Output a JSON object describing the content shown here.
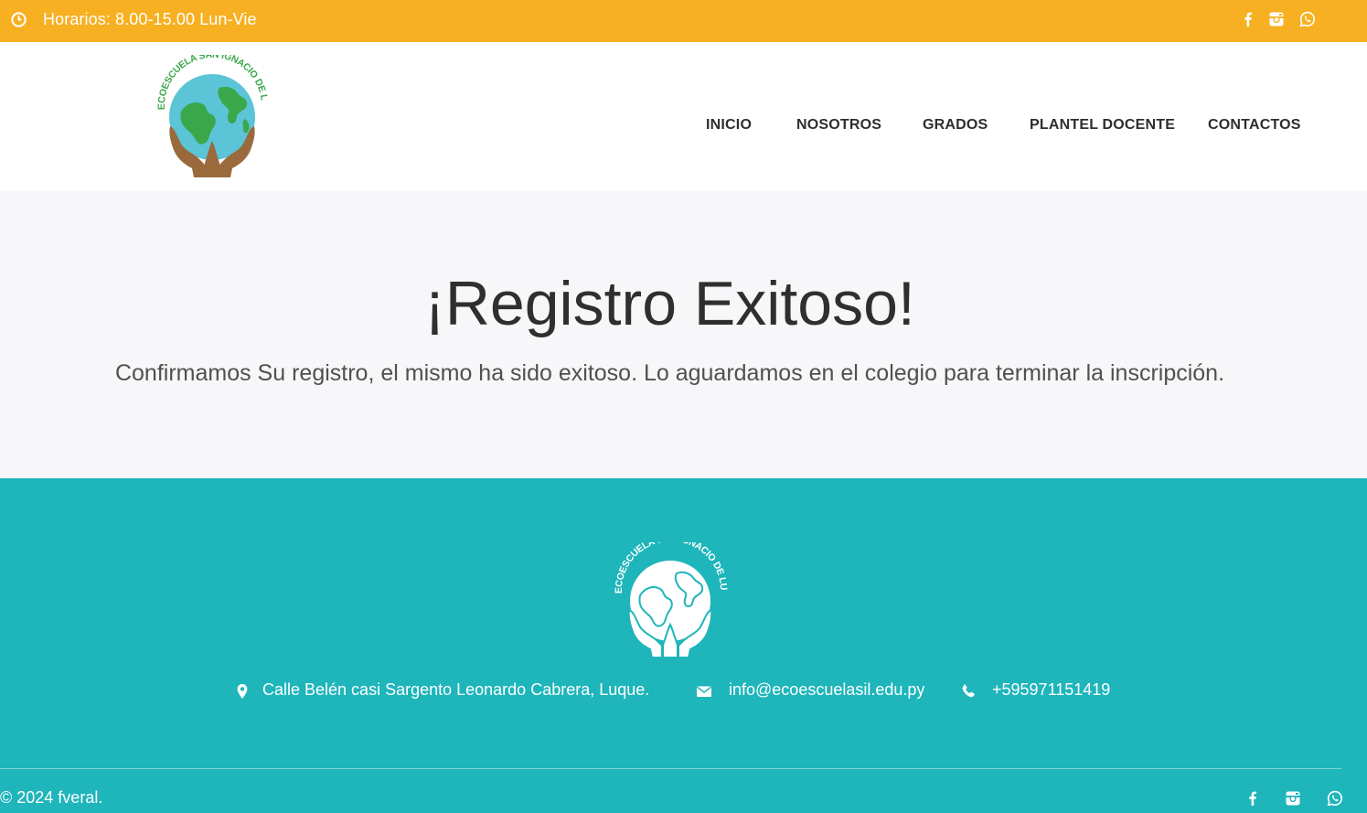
{
  "topbar": {
    "hours": "Horarios: 8.00-15.00 Lun-Vie"
  },
  "logo": {
    "text": "ECOESCUELA SAN IGNACIO DE LUQUE"
  },
  "nav": {
    "items": [
      "INICIO",
      "NOSOTROS",
      "GRADOS",
      "PLANTEL DOCENTE",
      "CONTACTOS"
    ]
  },
  "hero": {
    "title": "¡Registro Exitoso!",
    "message": "Confirmamos Su registro, el mismo ha sido exitoso. Lo aguardamos en el colegio para terminar la inscripción."
  },
  "footer": {
    "address": "Calle Belén casi Sargento Leonardo Cabrera, Luque.",
    "email": "info@ecoescuelasil.edu.py",
    "phone": "+595971151419",
    "copyright": "© 2024 fveral."
  },
  "colors": {
    "topbar": "#f6b021",
    "footer": "#1eb5bb",
    "hero_bg": "#f7f7f9"
  }
}
